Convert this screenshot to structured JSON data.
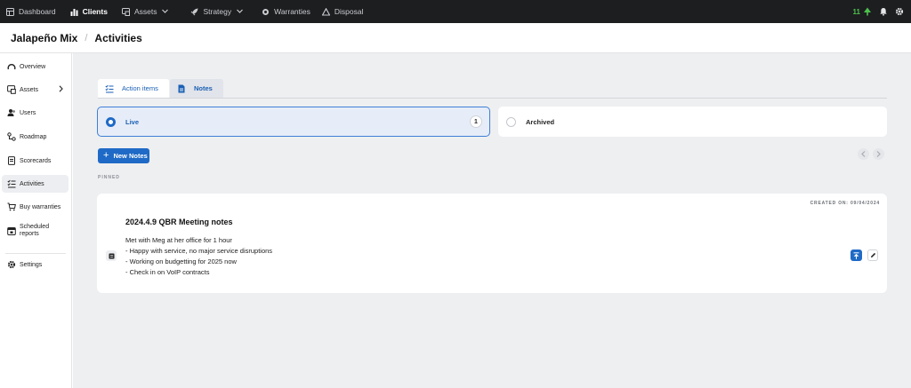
{
  "topnav": {
    "items": [
      {
        "label": "Dashboard",
        "icon": "dashboard-icon"
      },
      {
        "label": "Clients",
        "icon": "bar-chart-icon"
      },
      {
        "label": "Assets",
        "icon": "assets-icon"
      },
      {
        "label": "Strategy",
        "icon": "rocket-icon"
      },
      {
        "label": "Warranties",
        "icon": "warranty-icon"
      },
      {
        "label": "Disposal",
        "icon": "recycle-icon"
      }
    ],
    "active": "Clients",
    "tree_count": "11"
  },
  "header": {
    "client": "Jalapeño Mix",
    "separator": "/",
    "page": "Activities"
  },
  "sidebar": {
    "items": [
      {
        "label": "Overview",
        "icon": "overview-icon"
      },
      {
        "label": "Assets",
        "icon": "assets-icon"
      },
      {
        "label": "Users",
        "icon": "users-icon"
      },
      {
        "label": "Roadmap",
        "icon": "roadmap-icon"
      },
      {
        "label": "Scorecards",
        "icon": "scorecard-icon"
      },
      {
        "label": "Activities",
        "icon": "activities-icon"
      },
      {
        "label": "Buy warranties",
        "icon": "cart-icon"
      },
      {
        "label": "Scheduled",
        "label2": "reports",
        "icon": "calendar-icon"
      },
      {
        "label": "Settings",
        "icon": "gear-icon"
      }
    ],
    "active": "Activities"
  },
  "tabs": [
    {
      "label": "Action items"
    },
    {
      "label": "Notes"
    }
  ],
  "filters": {
    "live": {
      "label": "Live",
      "count": "1"
    },
    "archived": {
      "label": "Archived"
    }
  },
  "new_button": "New Notes",
  "pinned_label": "PINNED",
  "note": {
    "created": "CREATED ON: 09/04/2024",
    "title": "2024.4.9 QBR Meeting notes",
    "lines": [
      "Met with Meg at her office for 1 hour",
      "- Happy with service, no major service disruptions",
      "- Working on budgetting for 2025 now",
      "- Check in on VoIP contracts"
    ]
  },
  "colors": {
    "accent": "#1f6ac6",
    "nav_bg": "#1d1e20",
    "tree_green": "#4cc24c"
  }
}
